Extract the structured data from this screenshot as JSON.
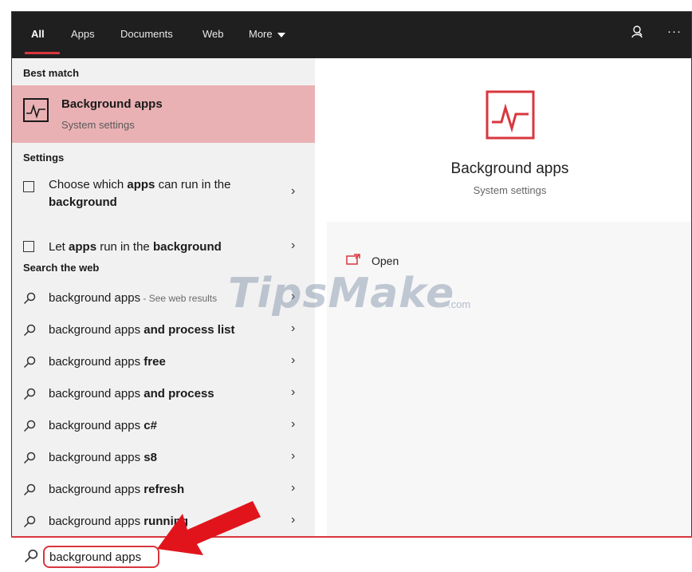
{
  "tabs": [
    {
      "label": "All",
      "active": true
    },
    {
      "label": "Apps"
    },
    {
      "label": "Documents"
    },
    {
      "label": "Web"
    },
    {
      "label": "More"
    }
  ],
  "topbar_icons": [
    "feedback-icon",
    "more-options-icon"
  ],
  "more_options_label": "···",
  "best_match": {
    "header": "Best match",
    "title": "Background apps",
    "subtitle": "System settings"
  },
  "settings": {
    "header": "Settings",
    "items": [
      {
        "prefix": "Choose which ",
        "bold1": "apps",
        "middle": " can run in the",
        "bold2": "background"
      },
      {
        "prefix": "Let ",
        "bold1": "apps",
        "middle": " run in the ",
        "bold2": "background"
      }
    ]
  },
  "web": {
    "header": "Search the web",
    "items": [
      {
        "base": "background apps",
        "bold": "",
        "hint": " - See web results"
      },
      {
        "base": "background apps ",
        "bold": "and process list",
        "hint": ""
      },
      {
        "base": "background apps ",
        "bold": "free",
        "hint": ""
      },
      {
        "base": "background apps ",
        "bold": "and process",
        "hint": ""
      },
      {
        "base": "background apps ",
        "bold": "c#",
        "hint": ""
      },
      {
        "base": "background apps ",
        "bold": "s8",
        "hint": ""
      },
      {
        "base": "background apps ",
        "bold": "refresh",
        "hint": ""
      },
      {
        "base": "background apps ",
        "bold": "running",
        "hint": ""
      }
    ]
  },
  "preview": {
    "title": "Background apps",
    "subtitle": "System settings",
    "open_label": "Open"
  },
  "search": {
    "value": "background apps"
  },
  "watermark": {
    "main": "TipsMake",
    "suffix": ".com"
  },
  "colors": {
    "accent": "#d9363e",
    "highlight": "#eab1b4",
    "topbar": "#1f1f1f"
  }
}
